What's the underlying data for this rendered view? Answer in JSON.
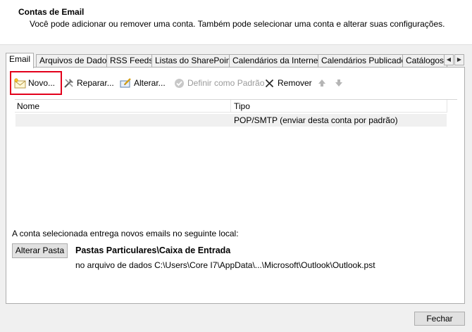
{
  "header": {
    "title": "Contas de Email",
    "description": "Você pode adicionar ou remover uma conta. Também pode selecionar uma conta e alterar suas configurações."
  },
  "tabs": [
    {
      "label": "Email",
      "active": true
    },
    {
      "label": "Arquivos de Dados"
    },
    {
      "label": "RSS Feeds"
    },
    {
      "label": "Listas do SharePoint"
    },
    {
      "label": "Calendários da Internet"
    },
    {
      "label": "Calendários Publicados"
    },
    {
      "label": "Catálogos"
    }
  ],
  "toolbar": {
    "new_label": "Novo...",
    "repair_label": "Reparar...",
    "change_label": "Alterar...",
    "set_default_label": "Definir como Padrão",
    "remove_label": "Remover"
  },
  "list": {
    "columns": [
      "Nome",
      "Tipo"
    ],
    "rows": [
      {
        "name": "",
        "type": "POP/SMTP (enviar desta conta por padrão)"
      }
    ]
  },
  "delivery": {
    "label": "A conta selecionada entrega novos emails no seguinte local:",
    "change_folder_label": "Alterar Pasta",
    "folder": "Pastas Particulares\\Caixa de Entrada",
    "path": "no arquivo de dados C:\\Users\\Core I7\\AppData\\...\\Microsoft\\Outlook\\Outlook.pst"
  },
  "footer": {
    "close_label": "Fechar"
  },
  "colors": {
    "highlight": "#e3001b",
    "dialog_bg": "#f0f0f0"
  }
}
